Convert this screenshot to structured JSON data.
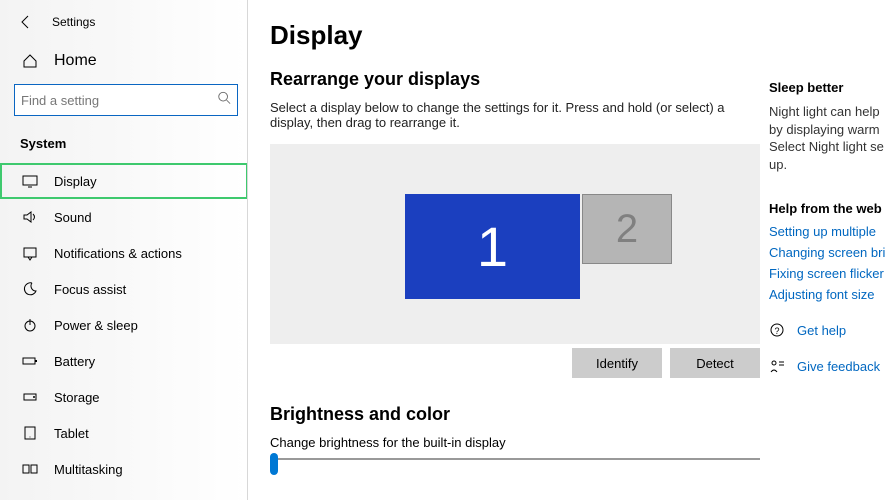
{
  "header": {
    "back": "←",
    "title": "Settings"
  },
  "home": "Home",
  "search": {
    "placeholder": "Find a setting"
  },
  "section": "System",
  "nav": {
    "display": "Display",
    "sound": "Sound",
    "notifications": "Notifications & actions",
    "focus": "Focus assist",
    "power": "Power & sleep",
    "battery": "Battery",
    "storage": "Storage",
    "tablet": "Tablet",
    "multitasking": "Multitasking"
  },
  "main": {
    "title": "Display",
    "rearrange_title": "Rearrange your displays",
    "rearrange_desc": "Select a display below to change the settings for it. Press and hold (or select) a display, then drag to rearrange it.",
    "monitor1": "1",
    "monitor2": "2",
    "identify": "Identify",
    "detect": "Detect",
    "brightness_title": "Brightness and color",
    "brightness_label": "Change brightness for the built-in display"
  },
  "right": {
    "sleep_head": "Sleep better",
    "sleep_text": "Night light can help by displaying warm Select Night light se up.",
    "help_head": "Help from the web",
    "link1": "Setting up multiple",
    "link2": "Changing screen bri",
    "link3": "Fixing screen flicker",
    "link4": "Adjusting font size",
    "gethelp": "Get help",
    "feedback": "Give feedback"
  }
}
